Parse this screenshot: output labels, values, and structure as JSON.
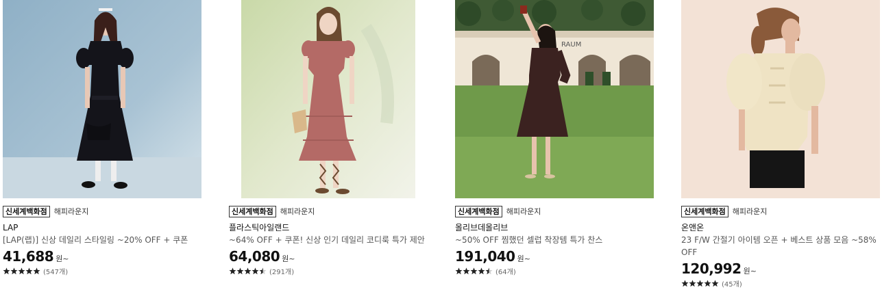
{
  "products": [
    {
      "store_tag": "신세계백화점",
      "store_sub": "해피라운지",
      "brand": "LAP",
      "title": "[LAP(랩)] 신상 데일리 스타일링 ~20% OFF + 쿠폰",
      "price": "41,688",
      "currency": "원~",
      "rating_stars": 5,
      "reviews": "(547개)",
      "image_icon": "black-dress-photo"
    },
    {
      "store_tag": "신세계백화점",
      "store_sub": "해피라운지",
      "brand": "플라스틱아일랜드",
      "title": "~64% OFF + 쿠폰! 신상 인기 데일리 코디룩 특가 제안",
      "price": "64,080",
      "currency": "원~",
      "rating_stars": 4.5,
      "reviews": "(291개)",
      "image_icon": "rose-dress-photo"
    },
    {
      "store_tag": "신세계백화점",
      "store_sub": "해피라운지",
      "brand": "올리브데올리브",
      "title": "~50% OFF 찜했던 셀럽 착장템 특가 찬스",
      "price": "191,040",
      "currency": "원~",
      "rating_stars": 4.5,
      "reviews": "(64개)",
      "image_icon": "brown-dress-garden-photo",
      "image_sign": "RAUM"
    },
    {
      "store_tag": "신세계백화점",
      "store_sub": "해피라운지",
      "brand": "온앤온",
      "title": "23 F/W 간절기 아이템 오픈 + 베스트 상품 모음 ~58% OFF",
      "price": "120,992",
      "currency": "원~",
      "rating_stars": 5,
      "reviews": "(45개)",
      "image_icon": "cream-blouse-photo"
    }
  ],
  "colors": {
    "star": "#222222",
    "price": "#111111"
  }
}
